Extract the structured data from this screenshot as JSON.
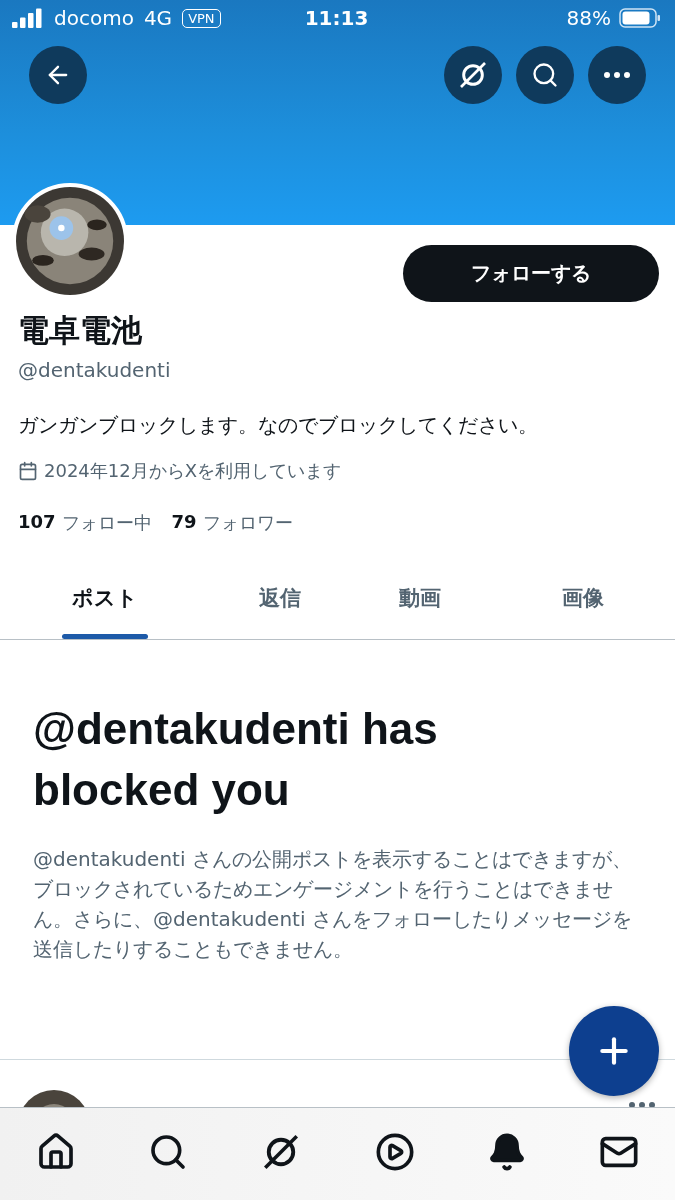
{
  "status_bar": {
    "carrier": "docomo",
    "network": "4G",
    "vpn": "VPN",
    "time": "11:13",
    "battery": "88%"
  },
  "profile": {
    "name": "電卓電池",
    "handle": "@dentakudenti",
    "bio": "ガンガンブロックします。なのでブロックしてください。",
    "joined": "2024年12月からXを利用しています",
    "following_count": "107",
    "following_label": "フォロー中",
    "followers_count": "79",
    "followers_label": "フォロワー",
    "follow_button": "フォローする"
  },
  "tabs": [
    {
      "label": "ポスト",
      "selected": true
    },
    {
      "label": "返信",
      "selected": false
    },
    {
      "label": "動画",
      "selected": false
    },
    {
      "label": "画像",
      "selected": false
    }
  ],
  "blocked": {
    "title": "@dentakudenti has blocked you",
    "message": "@dentakudenti さんの公開ポストを表示することはできますが、ブロックされているためエンゲージメントを行うことはできません。さらに、@dentakudenti さんをフォローしたりメッセージを送信したりすることもできません。"
  },
  "bottom_nav": [
    {
      "kind": "home"
    },
    {
      "kind": "search"
    },
    {
      "kind": "grok"
    },
    {
      "kind": "video"
    },
    {
      "kind": "bell"
    },
    {
      "kind": "mail"
    }
  ]
}
